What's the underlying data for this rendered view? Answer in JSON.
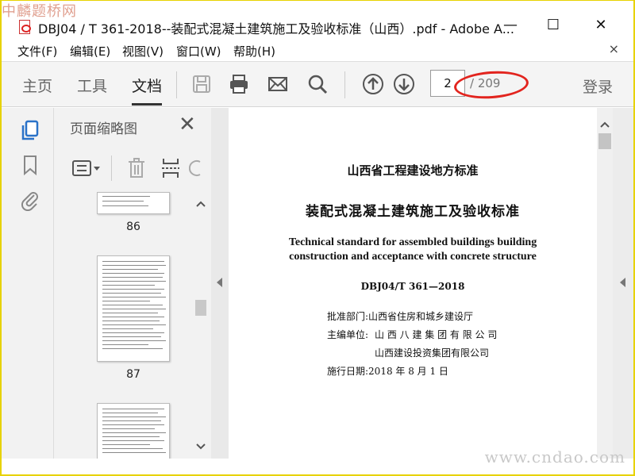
{
  "watermark_top": "中麟题桥网",
  "window": {
    "title": "DBJ04 / T 361-2018--装配式混凝土建筑施工及验收标准（山西）.pdf - Adobe A...",
    "minimize": "—",
    "maximize": "☐",
    "close": "✕"
  },
  "menu": {
    "items": [
      "文件(F)",
      "编辑(E)",
      "视图(V)",
      "窗口(W)",
      "帮助(H)"
    ],
    "close": "×"
  },
  "toolbar": {
    "tabs": [
      "主页",
      "工具",
      "文档"
    ],
    "active_tab": "文档",
    "page_current": "2",
    "page_total": "/ 209",
    "login": "登录"
  },
  "thumb_panel": {
    "title": "页面缩略图",
    "close": "✕",
    "pages": [
      "86",
      "87"
    ]
  },
  "document": {
    "heading1": "山西省工程建设地方标准",
    "heading2": "装配式混凝土建筑施工及验收标准",
    "english_line1": "Technical standard for assembled buildings building",
    "english_line2": "construction and acceptance with concrete structure",
    "code": "DBJ04/T 361—2018",
    "approval": "批准部门:山西省住房和城乡建设厅",
    "editor_label": "主编单位:",
    "editor1": "山 西 八 建 集 团 有 限 公 司",
    "editor2": "山西建设投资集团有限公司",
    "effective": "施行日期:2018 年 8 月 1 日"
  },
  "watermark_bottom": "www.cndao.com",
  "colors": {
    "frame_border": "#e7d200",
    "annotation_circle": "#e2241e",
    "accent_blue": "#2a72c8"
  }
}
